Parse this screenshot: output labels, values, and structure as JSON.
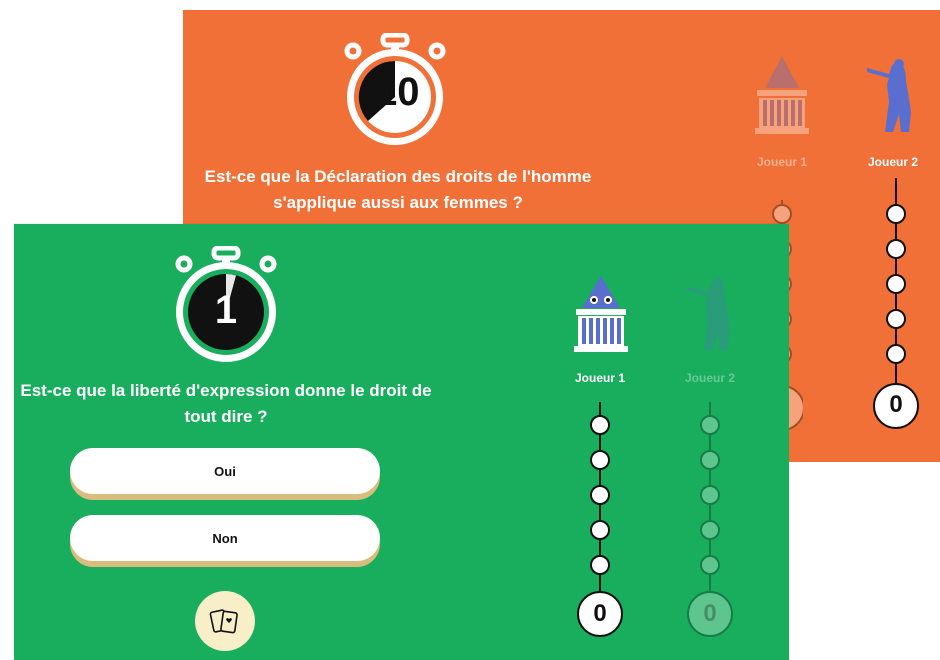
{
  "colors": {
    "orange": "#f07038",
    "green": "#19ad5e",
    "dark": "#111111",
    "highlight": "#d8bd7e"
  },
  "back_screen": {
    "timer": "10",
    "question": "Est-ce que la Déclaration des droits de l'homme s'applique aussi aux femmes ?",
    "players": [
      {
        "label": "Joueur 1",
        "icon": "building-icon",
        "active": false,
        "score": ""
      },
      {
        "label": "Joueur 2",
        "icon": "statue-icon",
        "active": true,
        "score": "0"
      }
    ]
  },
  "front_screen": {
    "timer": "1",
    "question": "Est-ce que la liberté d'expression donne le droit de tout dire ?",
    "answers": [
      "Oui",
      "Non"
    ],
    "card_button": "cards-icon",
    "players": [
      {
        "label": "Joueur 1",
        "icon": "building-icon",
        "active": true,
        "score": "0"
      },
      {
        "label": "Joueur 2",
        "icon": "statue-icon",
        "active": false,
        "score": "0"
      }
    ]
  }
}
